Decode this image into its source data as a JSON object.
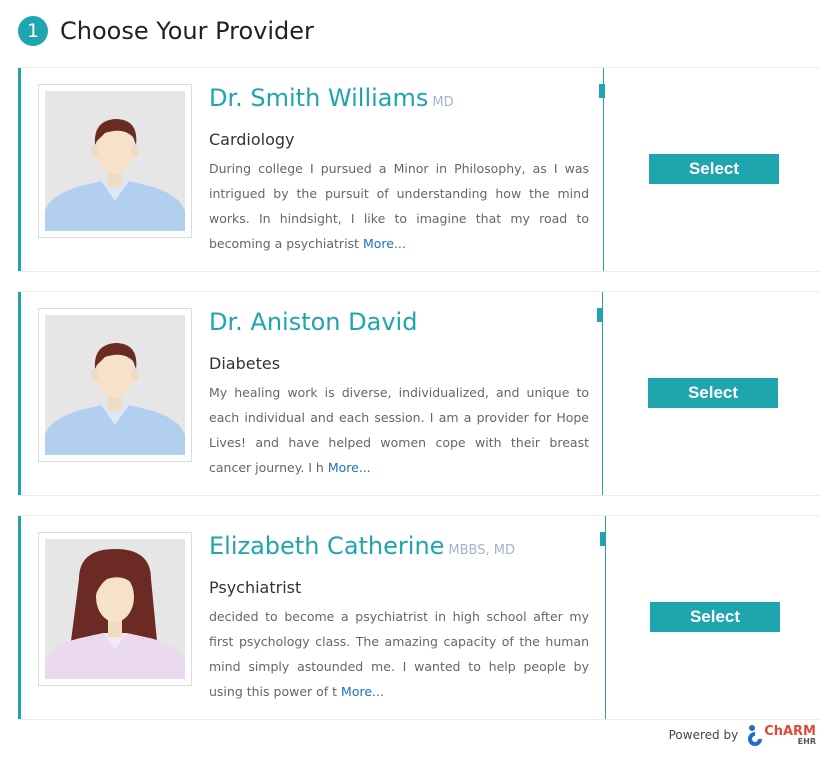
{
  "header": {
    "step": "1",
    "title": "Choose Your Provider"
  },
  "providers": [
    {
      "name": "Dr. Smith Williams",
      "credentials": "MD",
      "specialty": "Cardiology",
      "bio": "During college I pursued a Minor in Philosophy, as I was intrigued by the pursuit of understanding how the mind works. In hindsight, I like to imagine that my road to becoming a psychiatrist",
      "more_label": "More...",
      "select_label": "Select",
      "avatar": "male-avatar-icon"
    },
    {
      "name": "Dr. Aniston David",
      "credentials": "",
      "specialty": "Diabetes",
      "bio": "My healing work is diverse, individualized, and unique to each individual and each session. I am a provider for Hope Lives! and have helped women cope with their breast cancer journey. I h",
      "more_label": "More...",
      "select_label": "Select",
      "avatar": "male-avatar-icon"
    },
    {
      "name": "Elizabeth Catherine",
      "credentials": "MBBS, MD",
      "specialty": "Psychiatrist",
      "bio": "decided to become a psychiatrist in high school after my first psychology class. The amazing capacity of the human mind simply astounded me. I wanted to help people by using this power of t",
      "more_label": "More...",
      "select_label": "Select",
      "avatar": "female-avatar-icon"
    }
  ],
  "footer": {
    "powered_by": "Powered by",
    "brand": "ChARM",
    "brand_sub": "EHR"
  },
  "colors": {
    "accent": "#1ea5ad",
    "link": "#1f6fc7",
    "brand": "#e0493a"
  }
}
